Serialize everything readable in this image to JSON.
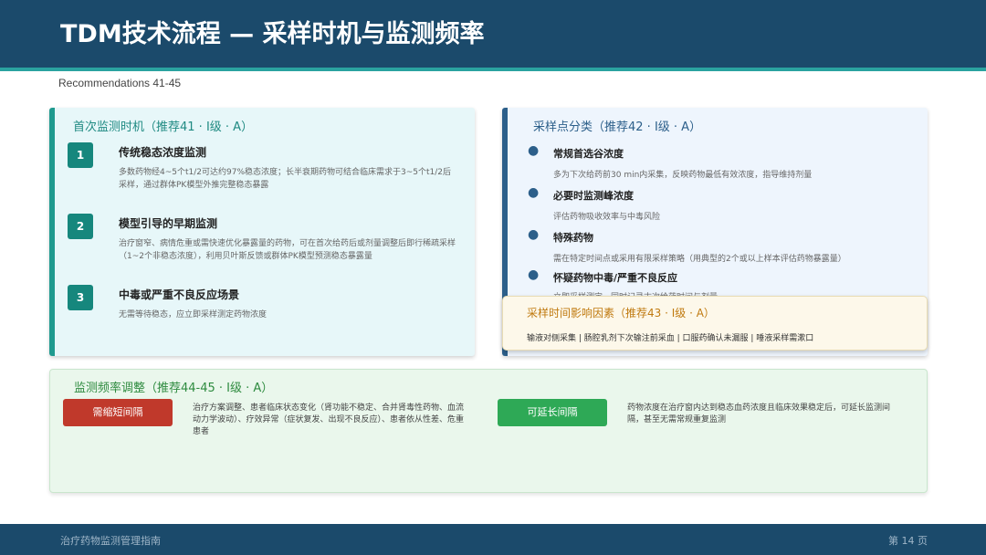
{
  "header": {
    "title": "TDM技术流程 — 采样时机与监测频率",
    "subtitle": "Recommendations 41-45"
  },
  "first_monitoring": {
    "heading": "首次监测时机（推荐41 · Ⅰ级 · A）",
    "items": [
      {
        "num": "1",
        "title": "传统稳态浓度监测",
        "desc": "多数药物经4~5个t1/2可达约97%稳态浓度；长半衰期药物可结合临床需求于3~5个t1/2后采样，通过群体PK模型外推完整稳态暴露"
      },
      {
        "num": "2",
        "title": "模型引导的早期监测",
        "desc": "治疗窗窄、病情危重或需快速优化暴露量的药物，可在首次给药后或剂量调整后即行稀疏采样（1~2个非稳态浓度），利用贝叶斯反馈或群体PK模型预测稳态暴露量"
      },
      {
        "num": "3",
        "title": "中毒或严重不良反应场景",
        "desc": "无需等待稳态，应立即采样测定药物浓度"
      }
    ]
  },
  "sampling_points": {
    "heading": "采样点分类（推荐42 · Ⅰ级 · A）",
    "items": [
      {
        "title": "常规首选谷浓度",
        "desc": "多为下次给药前30 min内采集，反映药物最低有效浓度，指导维持剂量"
      },
      {
        "title": "必要时监测峰浓度",
        "desc": "评估药物吸收效率与中毒风险"
      },
      {
        "title": "特殊药物",
        "desc": "需在特定时间点或采用有限采样策略（用典型的2个或以上样本评估药物暴露量）"
      },
      {
        "title": "怀疑药物中毒/严重不良反应",
        "desc": "立即采样测定，同时记录末次给药时间与剂量"
      }
    ]
  },
  "factors": {
    "heading": "采样时间影响因素（推荐43 · Ⅰ级 · A）",
    "text": "输液对侧采集 | 肠腔乳剂下次输注前采血 | 口服药确认未漏服 | 唾液采样需漱口"
  },
  "frequency": {
    "heading": "监测频率调整（推荐44-45 · Ⅰ级 · A）",
    "shorten_label": "需缩短间隔",
    "shorten_desc": "治疗方案调整、患者临床状态变化（肾功能不稳定、合并肾毒性药物、血流动力学波动）、疗效异常（症状复发、出现不良反应）、患者依从性差、危重患者",
    "extend_label": "可延长间隔",
    "extend_desc": "药物浓度在治疗窗内达到稳态血药浓度且临床效果稳定后，可延长监测间隔，甚至无需常规重复监测"
  },
  "footer": {
    "left": "治疗药物监测管理指南",
    "right": "第 14 页"
  },
  "colors": {
    "header_bg": "#1b4a6b",
    "accent_teal": "#1f9a8f",
    "accent_blue": "#2c5f8a",
    "warning_orange": "#c07a10",
    "tag_red": "#c0392b",
    "tag_green": "#2ea956"
  }
}
